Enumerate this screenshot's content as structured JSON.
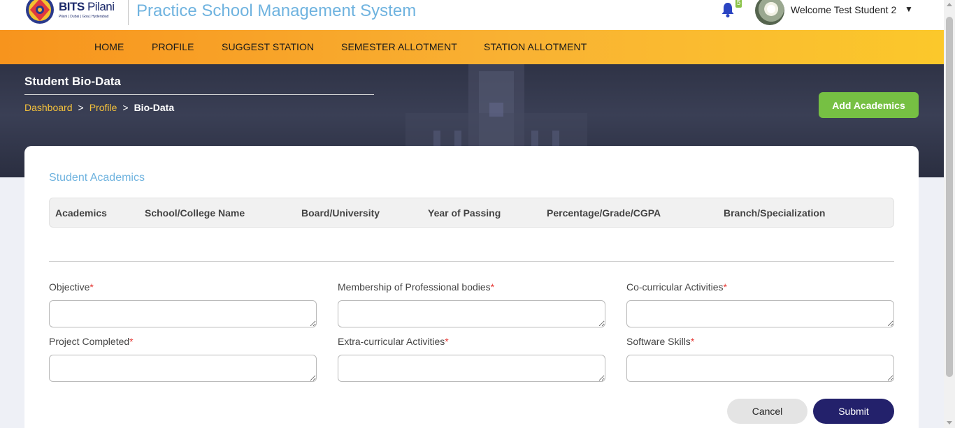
{
  "header": {
    "logo": {
      "brand_bold": "BITS",
      "brand_light": " Pilani",
      "campuses": "Pilani | Dubai | Goa | Hyderabad"
    },
    "app_title": "Practice School Management System",
    "notification_count": "5",
    "welcome_text": "Welcome Test Student 2",
    "user_menu_caret": "▼",
    "icons": {
      "bell": "bell-icon",
      "avatar": "avatar-flower"
    }
  },
  "nav": {
    "items": [
      {
        "label": "HOME"
      },
      {
        "label": "PROFILE"
      },
      {
        "label": "SUGGEST STATION"
      },
      {
        "label": "SEMESTER ALLOTMENT"
      },
      {
        "label": "STATION ALLOTMENT"
      }
    ]
  },
  "hero": {
    "page_title": "Student Bio-Data",
    "breadcrumb": [
      {
        "label": "Dashboard"
      },
      {
        "label": "Profile"
      },
      {
        "label": "Bio-Data"
      }
    ],
    "breadcrumb_separator": ">",
    "add_academics_label": "Add Academics"
  },
  "academics": {
    "section_title": "Student Academics",
    "columns": [
      "Academics",
      "School/College Name",
      "Board/University",
      "Year of Passing",
      "Percentage/Grade/CGPA",
      "Branch/Specialization"
    ],
    "rows": []
  },
  "form": {
    "required_marker": "*",
    "fields": [
      {
        "label": "Objective",
        "value": ""
      },
      {
        "label": "Membership of Professional bodies",
        "value": ""
      },
      {
        "label": "Co-curricular Activities",
        "value": ""
      },
      {
        "label": "Project Completed",
        "value": ""
      },
      {
        "label": "Extra-curricular Activities",
        "value": ""
      },
      {
        "label": "Software Skills",
        "value": ""
      }
    ],
    "cancel_label": "Cancel",
    "submit_label": "Submit"
  },
  "colors": {
    "accent_blue": "#6fb3df",
    "nav_orange": "#f7941d",
    "nav_yellow": "#fbc82b",
    "add_green": "#76c043",
    "submit_navy": "#23216b",
    "breadcrumb_gold": "#f5c23b",
    "required_red": "#e53935"
  }
}
